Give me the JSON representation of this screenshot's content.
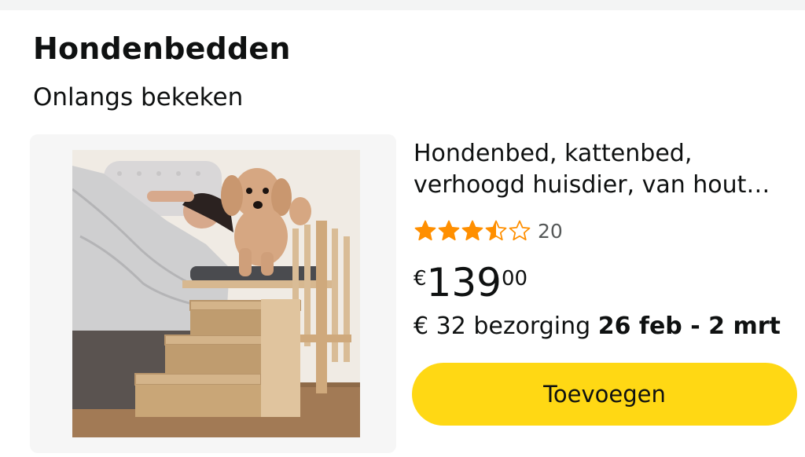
{
  "section": {
    "title": "Hondenbedden",
    "subtitle": "Onlangs bekeken"
  },
  "product": {
    "image_icon": "product-photo-dog-bed-stairs",
    "title": "Hondenbed, kattenbed, verhoogd huisdier, van hout…",
    "rating": 3.5,
    "rating_max": 5,
    "rating_count": "20",
    "price": {
      "symbol": "€",
      "whole": "139",
      "fraction": "00"
    },
    "delivery": {
      "prefix": "€ 32 bezorging ",
      "dates": "26 feb - 2 mrt"
    },
    "add_label": "Toevoegen"
  },
  "colors": {
    "star": "#ff8f00",
    "button": "#ffd814",
    "count_gray": "#565959"
  }
}
